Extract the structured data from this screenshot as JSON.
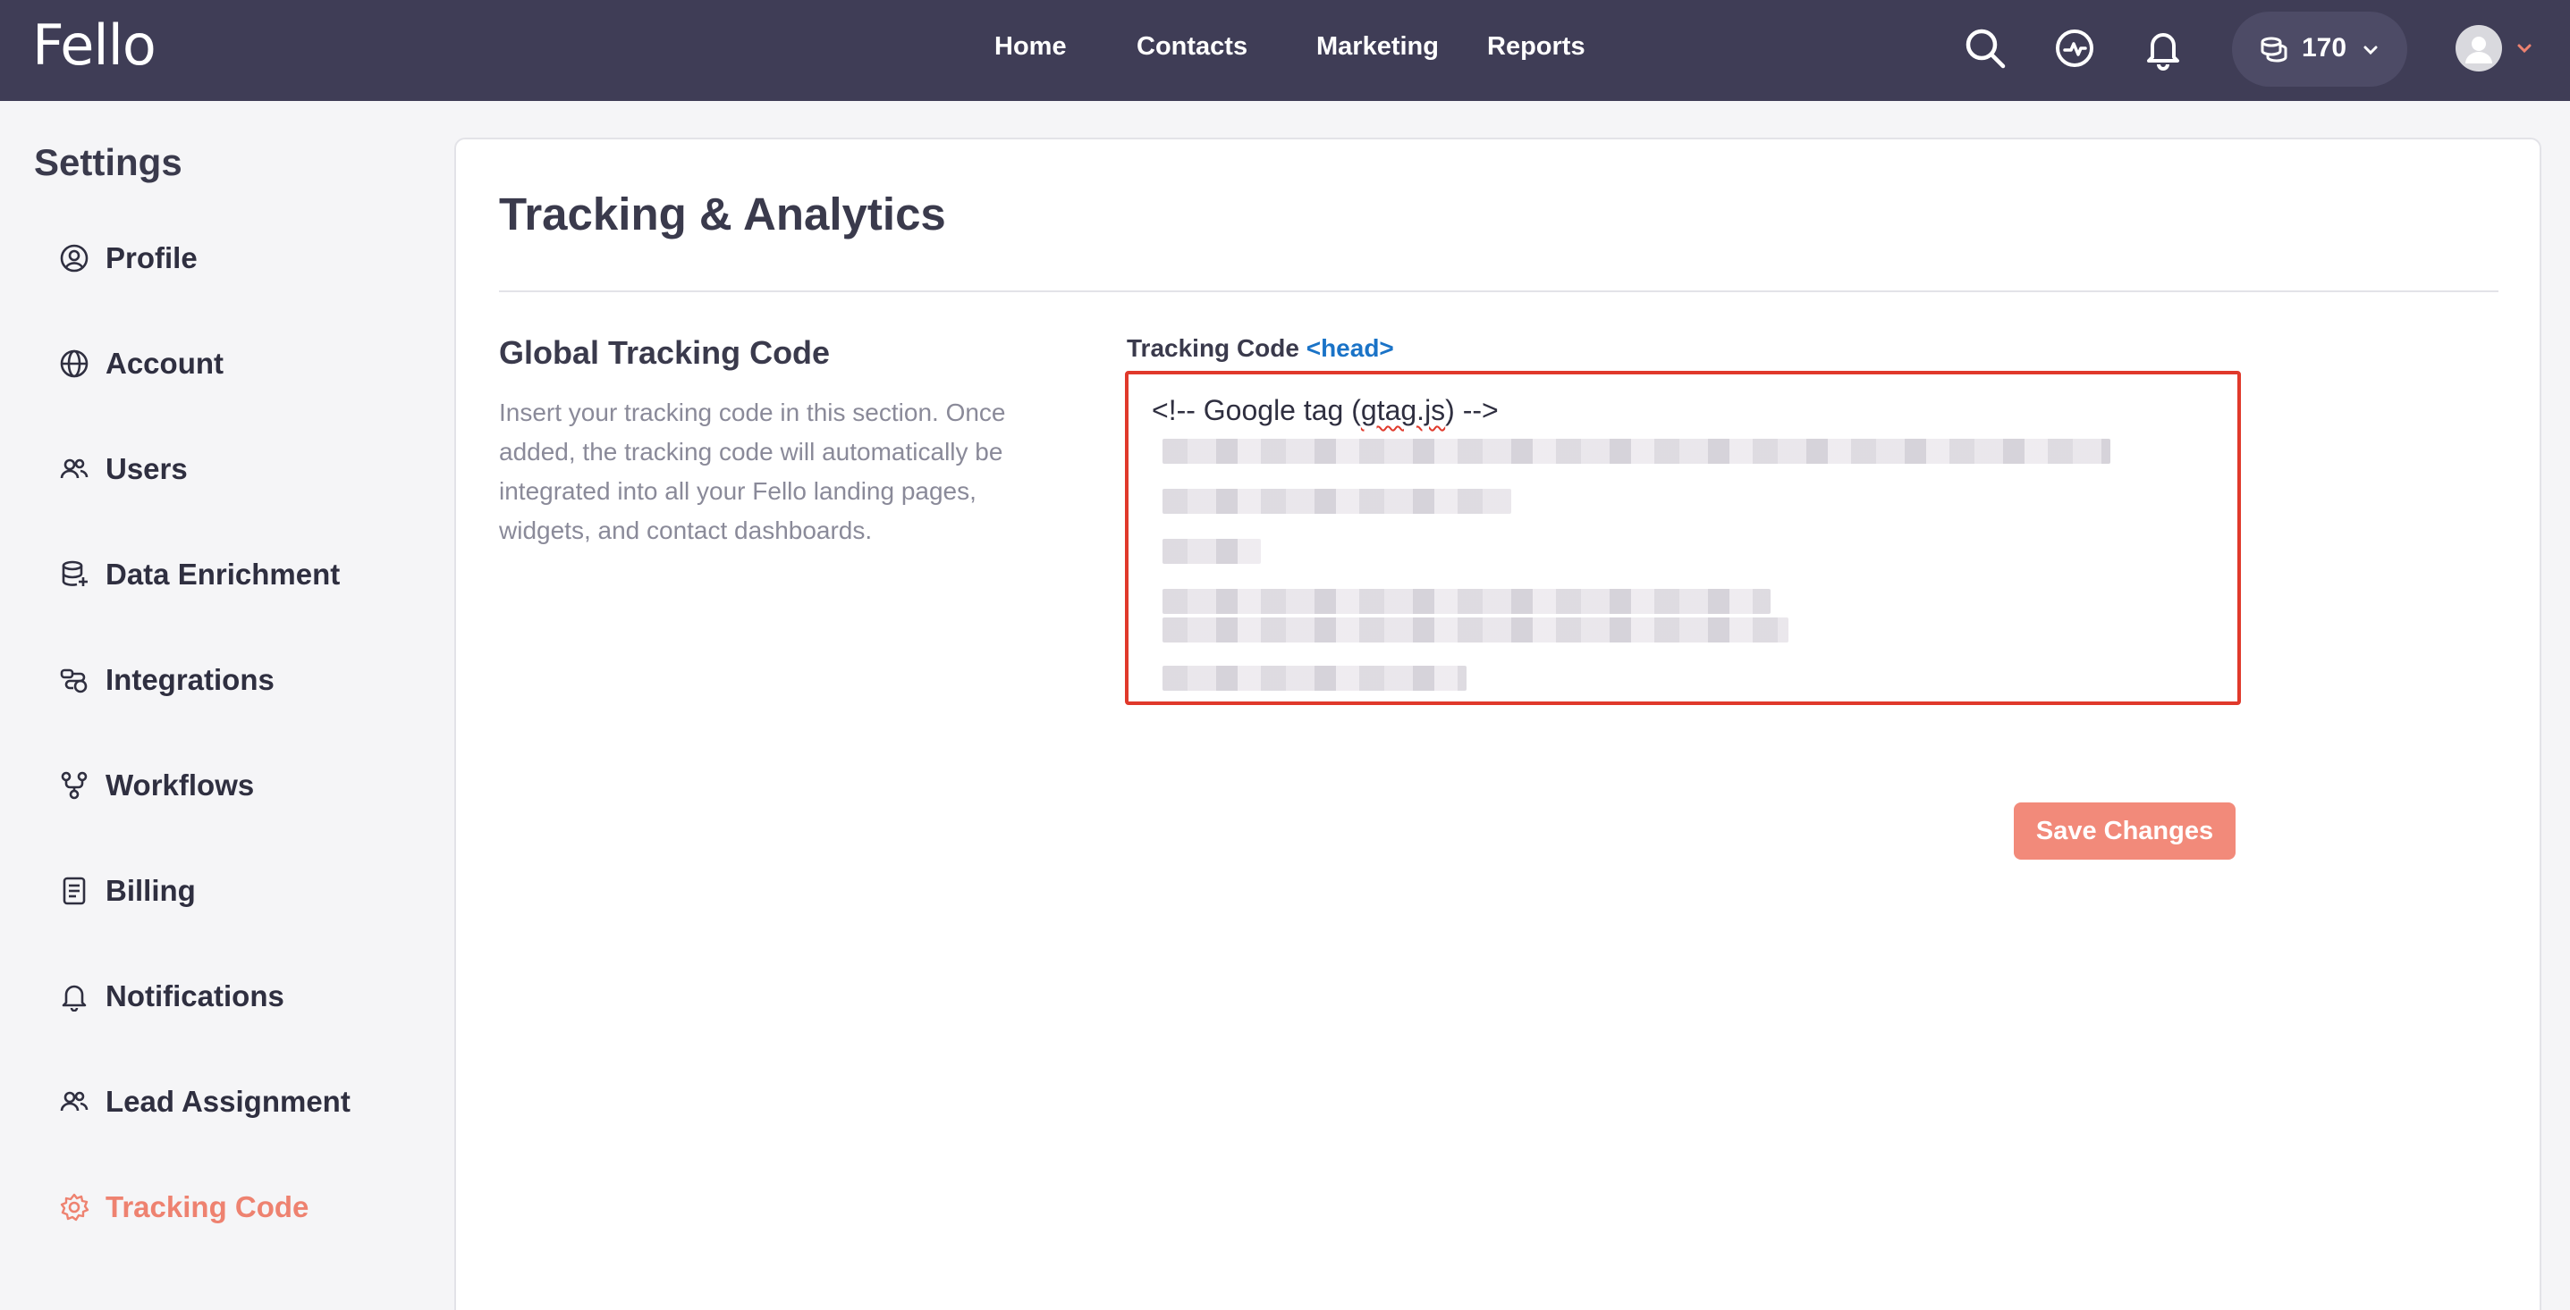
{
  "brand": {
    "logo_text": "Fello",
    "accent": "#ee8270",
    "topbar_bg": "#3f3d56"
  },
  "nav": {
    "items": [
      "Home",
      "Contacts",
      "Marketing",
      "Reports"
    ]
  },
  "topbar": {
    "icons": [
      "search-icon",
      "activity-icon",
      "bell-icon"
    ],
    "credits": "170"
  },
  "sidebar": {
    "title": "Settings",
    "items": [
      {
        "label": "Profile",
        "icon": "user-circle-icon"
      },
      {
        "label": "Account",
        "icon": "globe-icon"
      },
      {
        "label": "Users",
        "icon": "users-icon"
      },
      {
        "label": "Data Enrichment",
        "icon": "database-icon"
      },
      {
        "label": "Integrations",
        "icon": "integration-icon"
      },
      {
        "label": "Workflows",
        "icon": "workflow-icon"
      },
      {
        "label": "Billing",
        "icon": "document-icon"
      },
      {
        "label": "Notifications",
        "icon": "bell-icon"
      },
      {
        "label": "Lead Assignment",
        "icon": "users-icon"
      },
      {
        "label": "Tracking Code",
        "icon": "gear-icon",
        "active": true
      }
    ]
  },
  "main": {
    "title": "Tracking & Analytics",
    "section_title": "Global Tracking Code",
    "section_desc": "Insert your tracking code in this section. Once added, the tracking code will automatically be integrated into all your Fello landing pages, widgets, and contact dashboards.",
    "field_label": "Tracking Code",
    "field_tag": "<head>",
    "code_prefix": "<!-- Google tag (",
    "code_word": "gtag.js",
    "code_suffix": ") -->",
    "save_label": "Save Changes"
  }
}
